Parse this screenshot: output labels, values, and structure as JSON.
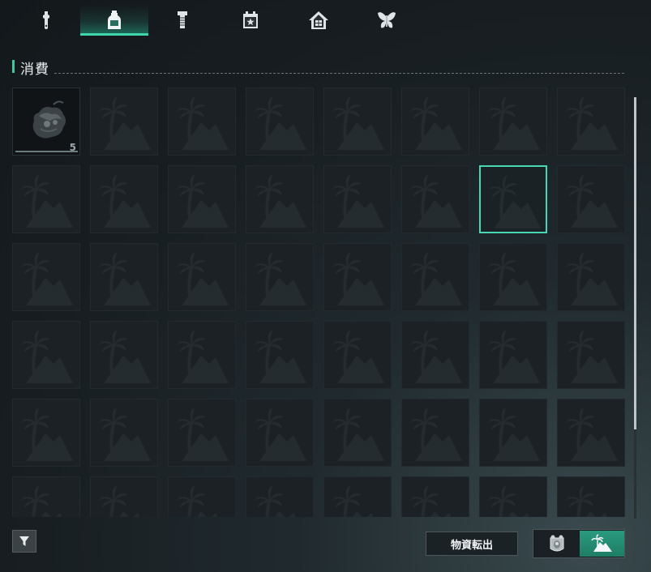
{
  "tabs": [
    {
      "icon": "wrench-icon",
      "active": false
    },
    {
      "icon": "bottle-icon",
      "active": true
    },
    {
      "icon": "screw-icon",
      "active": false
    },
    {
      "icon": "calendar-star-icon",
      "active": false
    },
    {
      "icon": "house-icon",
      "active": false
    },
    {
      "icon": "butterfly-icon",
      "active": false
    }
  ],
  "section": {
    "title": "消費"
  },
  "inventory": {
    "columns": 8,
    "visible_rows": 6,
    "selected_slot": 14,
    "items": [
      {
        "slot": 0,
        "icon": "creature-item-icon",
        "quantity": "5"
      }
    ]
  },
  "bottom": {
    "filter_icon": "filter-icon",
    "transfer_label": "物資転出",
    "toggle": [
      {
        "icon": "badge-icon",
        "active": false
      },
      {
        "icon": "island-icon",
        "active": true
      }
    ]
  },
  "colors": {
    "accent": "#3fd6ac",
    "selected_border": "#49d6b2"
  }
}
